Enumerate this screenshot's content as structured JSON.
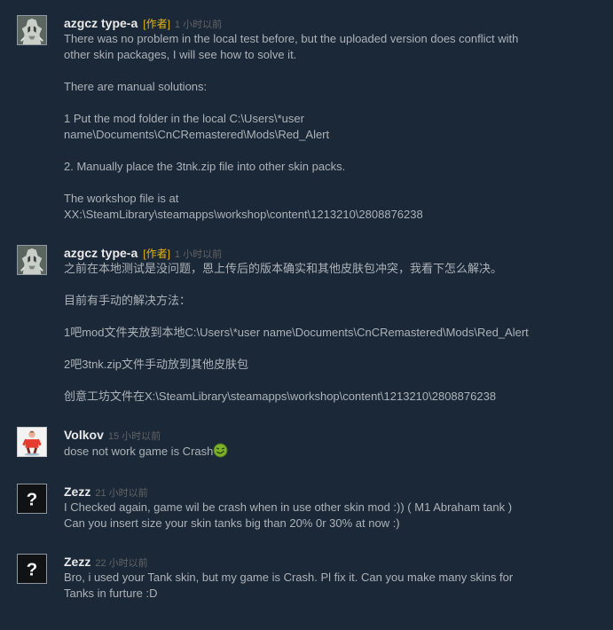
{
  "comments": [
    {
      "author": "azgcz type-a",
      "author_tag": "[作者]",
      "timestamp": "1 小时以前",
      "avatar_icon": "gray-gargoyle-avatar",
      "lines": [
        "There was no problem in the local test before, but the uploaded version does conflict with",
        "other skin packages, I will see how to solve it.",
        "",
        "There are manual solutions:",
        "",
        "1 Put the mod folder in the local C:\\Users\\*user",
        "name\\Documents\\CnCRemastered\\Mods\\Red_Alert",
        "",
        "2. Manually place the 3tnk.zip file into other skin packs.",
        "",
        "The workshop file is at",
        "XX:\\SteamLibrary\\steamapps\\workshop\\content\\1213210\\2808876238"
      ]
    },
    {
      "author": "azgcz type-a",
      "author_tag": "[作者]",
      "timestamp": "1 小时以前",
      "avatar_icon": "gray-gargoyle-avatar",
      "lines": [
        "之前在本地测试是没问题，恩上传后的版本确实和其他皮肤包冲突，我看下怎么解决。",
        "",
        "目前有手动的解决方法：",
        "",
        "1吧mod文件夹放到本地C:\\Users\\*user name\\Documents\\CnCRemastered\\Mods\\Red_Alert",
        "",
        "2吧3tnk.zip文件手动放到其他皮肤包",
        "",
        "创意工坊文件在X:\\SteamLibrary\\steamapps\\workshop\\content\\1213210\\2808876238"
      ]
    },
    {
      "author": "Volkov",
      "timestamp": "15 小时以前",
      "avatar_icon": "red-soldier-avatar",
      "text": "dose not work game is Crash",
      "emoticon": "green-laughing-emoticon"
    },
    {
      "author": "Zezz",
      "timestamp": "21 小时以前",
      "avatar_icon": "question-mark-avatar",
      "avatar_symbol": "?",
      "lines": [
        "I Checked again, game wil be crash when in use other skin mod :)) ( M1 Abraham tank )",
        "Can you insert size your skin tanks big than 20% 0r 30% at now :)"
      ]
    },
    {
      "author": "Zezz",
      "timestamp": "22 小时以前",
      "avatar_icon": "question-mark-avatar",
      "avatar_symbol": "?",
      "lines": [
        "Bro, i used your Tank skin, but my game is Crash. Pl fix it. Can you make many skins for",
        "Tanks in furture :D"
      ]
    }
  ]
}
